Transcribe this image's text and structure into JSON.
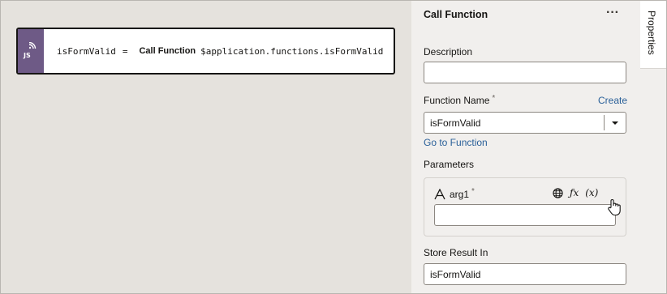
{
  "canvas": {
    "action": {
      "variable": "isFormValid",
      "operator": "=",
      "keyword": "Call Function",
      "expression": "$application.functions.isFormValid",
      "icon": "js-action-icon",
      "icon_color": "#6e5a86"
    }
  },
  "panel": {
    "title": "Call Function",
    "more_label": "···",
    "description": {
      "label": "Description",
      "value": ""
    },
    "function_name": {
      "label": "Function Name",
      "required_marker": "*",
      "create_label": "Create",
      "value": "isFormValid"
    },
    "goto_label": "Go to Function",
    "parameters": {
      "label": "Parameters",
      "items": [
        {
          "name": "arg1",
          "required_marker": "*",
          "value": ""
        }
      ]
    },
    "store_result": {
      "label": "Store Result In",
      "value": "isFormValid"
    }
  },
  "tabs": [
    {
      "label": "Properties",
      "active": true
    }
  ],
  "colors": {
    "link": "#2a6099",
    "canvas_bg": "#e5e2dd",
    "panel_bg": "#f1efed"
  }
}
